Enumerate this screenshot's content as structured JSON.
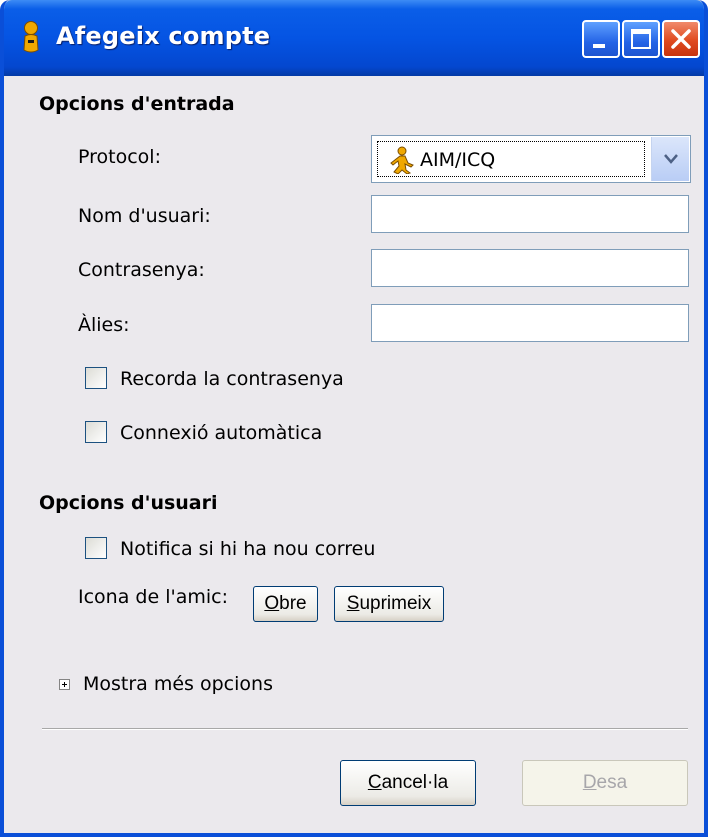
{
  "window": {
    "title": "Afegeix compte",
    "icon": "aim-running-man-icon"
  },
  "title_buttons": {
    "minimize": "minimize-icon",
    "maximize": "maximize-icon",
    "close": "close-icon"
  },
  "login_section": {
    "title": "Opcions d'entrada",
    "protocol_label": "Protocol:",
    "protocol_value": "AIM/ICQ",
    "username_label": "Nom d'usuari:",
    "username_value": "",
    "password_label": "Contrasenya:",
    "password_value": "",
    "alias_label": "Àlies:",
    "alias_value": "",
    "remember_password": {
      "label": "Recorda la contrasenya",
      "checked": false
    },
    "auto_login": {
      "label": "Connexió automàtica",
      "checked": false
    }
  },
  "user_section": {
    "title": "Opcions d'usuari",
    "notify_mail": {
      "label": "Notifica si hi ha nou correu",
      "checked": false
    },
    "buddy_icon_label": "Icona de l'amic:",
    "open_button": {
      "mnemonic": "O",
      "rest": "bre"
    },
    "remove_button": {
      "mnemonic": "S",
      "rest": "uprimeix"
    }
  },
  "more_options": {
    "label": "Mostra més opcions",
    "expanded": false
  },
  "footer": {
    "cancel_button": {
      "mnemonic": "C",
      "rest": "ancel·la"
    },
    "save_button": {
      "mnemonic": "D",
      "rest": "esa",
      "enabled": false
    }
  },
  "colors": {
    "titlebar": "#0554e3",
    "dialog_bg": "#ebe9ed",
    "accent_icon": "#f0a800"
  }
}
